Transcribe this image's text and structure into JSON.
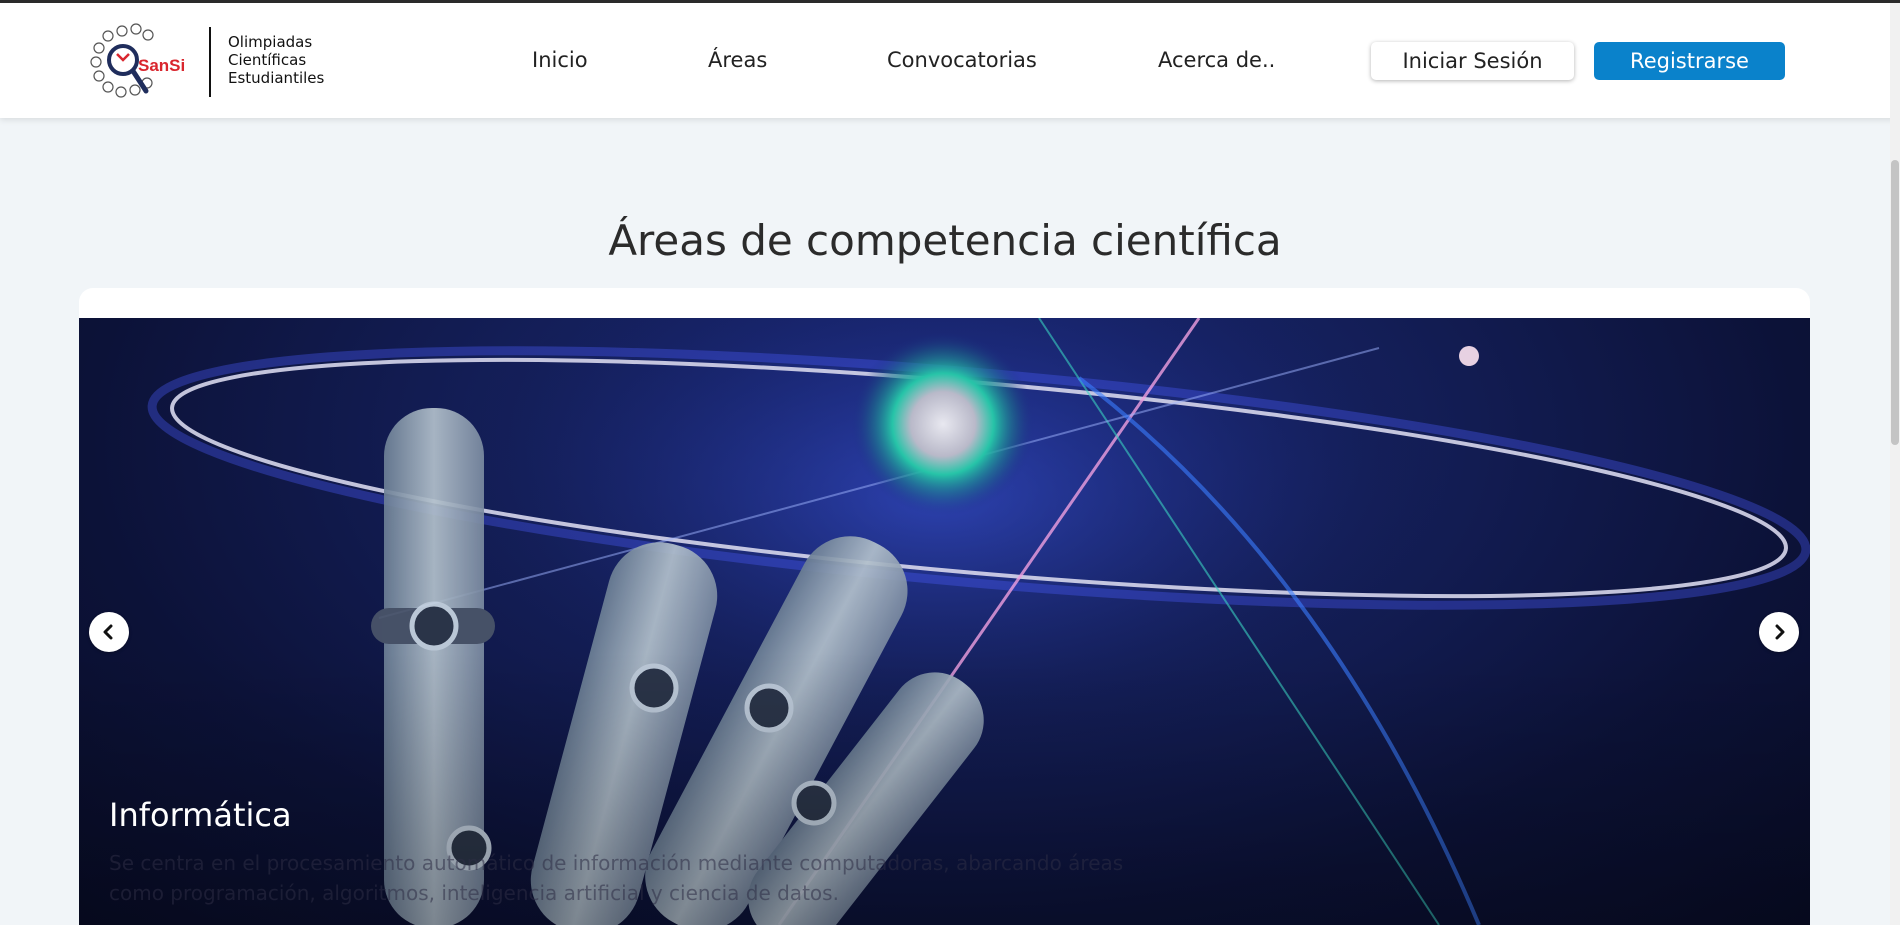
{
  "brand": {
    "logo_text": "SanSi",
    "line1": "Olimpiadas",
    "line2": "Científicas",
    "line3": "Estudiantiles"
  },
  "nav": {
    "items": [
      "Inicio",
      "Áreas",
      "Convocatorias",
      "Acerca de.."
    ],
    "login_label": "Iniciar Sesión",
    "register_label": "Registrarse"
  },
  "section": {
    "title": "Áreas de competencia científica"
  },
  "carousel": {
    "slide": {
      "title": "Informática",
      "description": "Se centra en el procesamiento automático de información mediante computadoras, abarcando áreas como programación, algoritmos, inteligencia artificial y ciencia de datos."
    },
    "prev_icon": "chevron-left-icon",
    "next_icon": "chevron-right-icon"
  },
  "colors": {
    "accent": "#0a82cb",
    "page_background": "#f1f5f8",
    "logo_red": "#d9262e"
  }
}
